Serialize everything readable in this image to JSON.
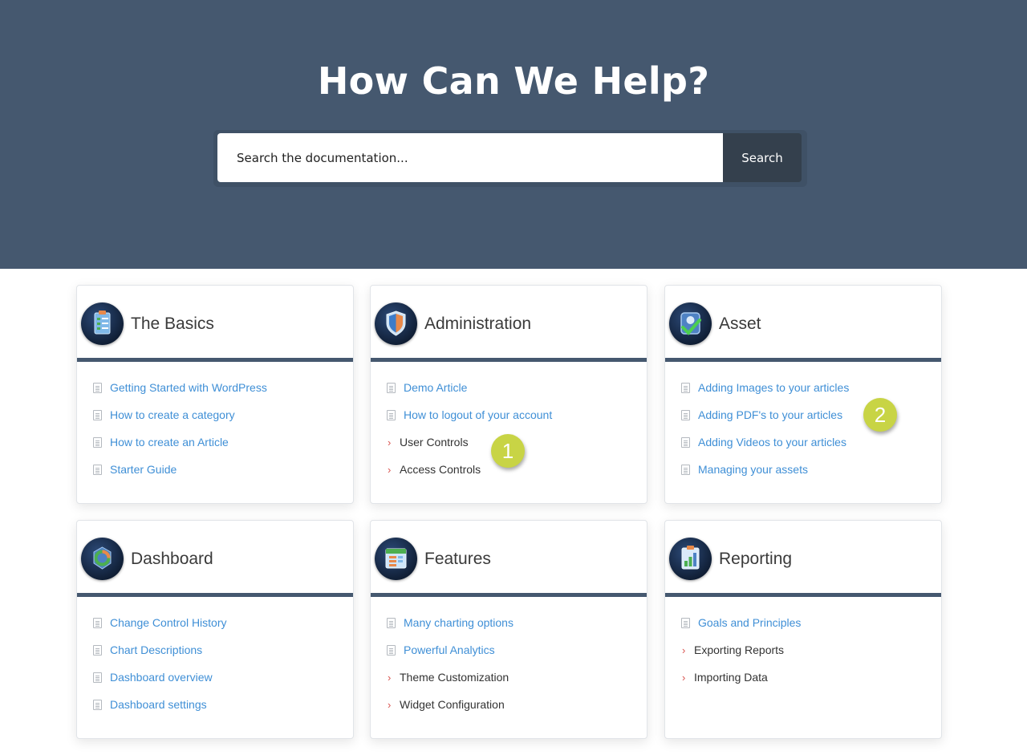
{
  "hero": {
    "title": "How Can We Help?",
    "search_placeholder": "Search the documentation...",
    "search_button": "Search",
    "background_color": "#45586f"
  },
  "cards": [
    {
      "title": "The Basics",
      "icon": "clipboard-list-icon",
      "items": [
        {
          "label": "Getting Started with WordPress",
          "type": "article"
        },
        {
          "label": "How to create a category",
          "type": "article"
        },
        {
          "label": "How to create an Article",
          "type": "article"
        },
        {
          "label": "Starter Guide",
          "type": "article"
        }
      ]
    },
    {
      "title": "Administration",
      "icon": "shield-icon",
      "items": [
        {
          "label": "Demo Article",
          "type": "article"
        },
        {
          "label": "How to logout of your account",
          "type": "article"
        },
        {
          "label": "User Controls",
          "type": "category"
        },
        {
          "label": "Access Controls",
          "type": "category"
        }
      ]
    },
    {
      "title": "Asset",
      "icon": "check-badge-icon",
      "items": [
        {
          "label": "Adding Images to your articles",
          "type": "article"
        },
        {
          "label": "Adding PDF's to your articles",
          "type": "article"
        },
        {
          "label": "Adding Videos to your articles",
          "type": "article"
        },
        {
          "label": "Managing your assets",
          "type": "article"
        }
      ]
    },
    {
      "title": "Dashboard",
      "icon": "refresh-cycle-icon",
      "items": [
        {
          "label": "Change Control History",
          "type": "article"
        },
        {
          "label": "Chart Descriptions",
          "type": "article"
        },
        {
          "label": "Dashboard overview",
          "type": "article"
        },
        {
          "label": "Dashboard settings",
          "type": "article"
        }
      ]
    },
    {
      "title": "Features",
      "icon": "calendar-list-icon",
      "items": [
        {
          "label": "Many charting options",
          "type": "article"
        },
        {
          "label": "Powerful Analytics",
          "type": "article"
        },
        {
          "label": "Theme Customization",
          "type": "category"
        },
        {
          "label": "Widget Configuration",
          "type": "category"
        }
      ]
    },
    {
      "title": "Reporting",
      "icon": "bar-chart-clipboard-icon",
      "items": [
        {
          "label": "Goals and Principles",
          "type": "article"
        },
        {
          "label": "Exporting Reports",
          "type": "category"
        },
        {
          "label": "Importing Data",
          "type": "category"
        }
      ]
    }
  ],
  "badges": [
    "1",
    "2"
  ],
  "colors": {
    "article_link": "#3f8fd6",
    "category_text": "#333333",
    "chevron": "#d9534f",
    "badge": "#c8d445",
    "card_divider": "#45586f"
  }
}
